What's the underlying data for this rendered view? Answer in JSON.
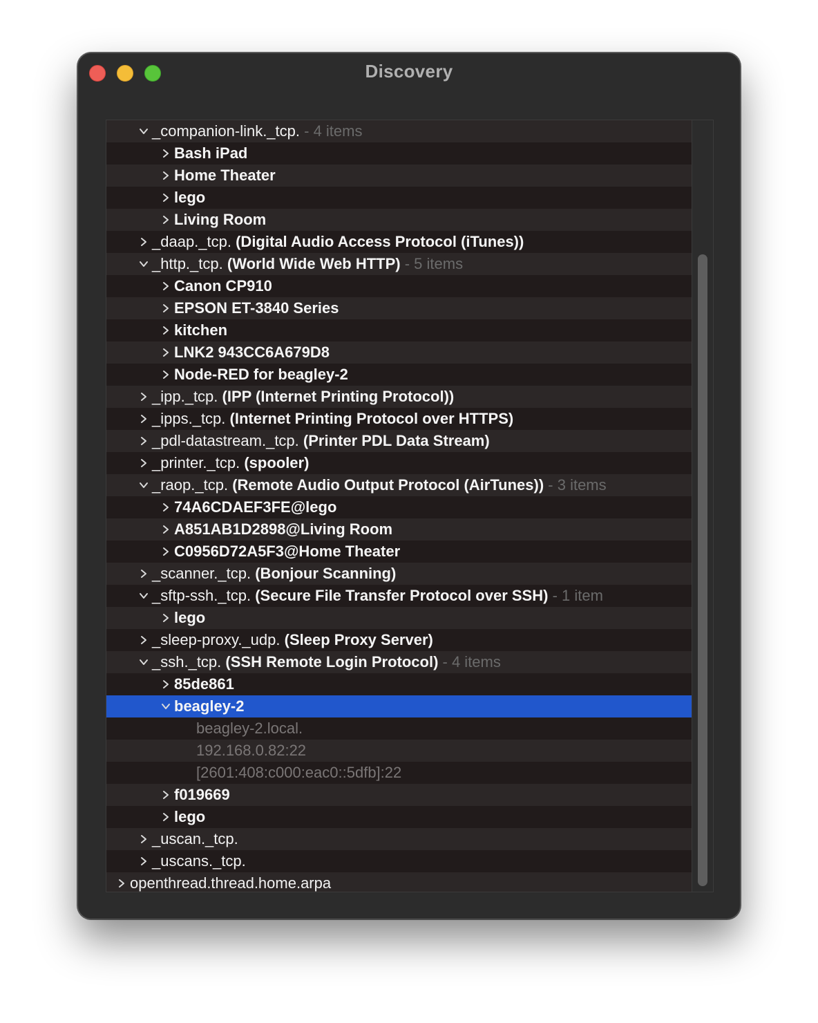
{
  "window": {
    "title": "Discovery"
  },
  "tree": {
    "rows": [
      {
        "indent": 1,
        "expanded": true,
        "name": "_companion-link._tcp.",
        "desc": "",
        "count": " - 4 items",
        "style": "service"
      },
      {
        "indent": 2,
        "expanded": false,
        "name": "Bash iPad",
        "style": "instance"
      },
      {
        "indent": 2,
        "expanded": false,
        "name": "Home Theater",
        "style": "instance"
      },
      {
        "indent": 2,
        "expanded": false,
        "name": "lego",
        "style": "instance"
      },
      {
        "indent": 2,
        "expanded": false,
        "name": "Living Room",
        "style": "instance"
      },
      {
        "indent": 1,
        "expanded": false,
        "name": "_daap._tcp.",
        "desc": "(Digital Audio Access Protocol (iTunes))",
        "count": "",
        "style": "service"
      },
      {
        "indent": 1,
        "expanded": true,
        "name": "_http._tcp.",
        "desc": "(World Wide Web HTTP)",
        "count": " - 5 items",
        "style": "service"
      },
      {
        "indent": 2,
        "expanded": false,
        "name": "Canon CP910",
        "style": "instance"
      },
      {
        "indent": 2,
        "expanded": false,
        "name": "EPSON ET-3840 Series",
        "style": "instance"
      },
      {
        "indent": 2,
        "expanded": false,
        "name": "kitchen",
        "style": "instance"
      },
      {
        "indent": 2,
        "expanded": false,
        "name": "LNK2 943CC6A679D8",
        "style": "instance"
      },
      {
        "indent": 2,
        "expanded": false,
        "name": "Node-RED for beagley-2",
        "style": "instance"
      },
      {
        "indent": 1,
        "expanded": false,
        "name": "_ipp._tcp.",
        "desc": "(IPP (Internet Printing Protocol))",
        "count": "",
        "style": "service"
      },
      {
        "indent": 1,
        "expanded": false,
        "name": "_ipps._tcp.",
        "desc": "(Internet Printing Protocol over HTTPS)",
        "count": "",
        "style": "service"
      },
      {
        "indent": 1,
        "expanded": false,
        "name": "_pdl-datastream._tcp.",
        "desc": "(Printer PDL Data Stream)",
        "count": "",
        "style": "service"
      },
      {
        "indent": 1,
        "expanded": false,
        "name": "_printer._tcp.",
        "desc": "(spooler)",
        "count": "",
        "style": "service"
      },
      {
        "indent": 1,
        "expanded": true,
        "name": "_raop._tcp.",
        "desc": "(Remote Audio Output Protocol (AirTunes))",
        "count": " - 3 items",
        "style": "service"
      },
      {
        "indent": 2,
        "expanded": false,
        "name": "74A6CDAEF3FE@lego",
        "style": "instance"
      },
      {
        "indent": 2,
        "expanded": false,
        "name": "A851AB1D2898@Living Room",
        "style": "instance"
      },
      {
        "indent": 2,
        "expanded": false,
        "name": "C0956D72A5F3@Home Theater",
        "style": "instance"
      },
      {
        "indent": 1,
        "expanded": false,
        "name": "_scanner._tcp.",
        "desc": "(Bonjour Scanning)",
        "count": "",
        "style": "service"
      },
      {
        "indent": 1,
        "expanded": true,
        "name": "_sftp-ssh._tcp.",
        "desc": "(Secure File Transfer Protocol over SSH)",
        "count": " - 1 item",
        "style": "service"
      },
      {
        "indent": 2,
        "expanded": false,
        "name": "lego",
        "style": "instance"
      },
      {
        "indent": 1,
        "expanded": false,
        "name": "_sleep-proxy._udp.",
        "desc": "(Sleep Proxy Server)",
        "count": "",
        "style": "service"
      },
      {
        "indent": 1,
        "expanded": true,
        "name": "_ssh._tcp.",
        "desc": "(SSH Remote Login Protocol)",
        "count": " - 4 items",
        "style": "service"
      },
      {
        "indent": 2,
        "expanded": false,
        "name": "85de861",
        "style": "instance"
      },
      {
        "indent": 2,
        "expanded": true,
        "name": "beagley-2",
        "style": "instance",
        "selected": true
      },
      {
        "indent": 3,
        "name": "beagley-2.local.",
        "style": "detail"
      },
      {
        "indent": 3,
        "name": "192.168.0.82:22",
        "style": "detail"
      },
      {
        "indent": 3,
        "name": "[2601:408:c000:eac0::5dfb]:22",
        "style": "detail"
      },
      {
        "indent": 2,
        "expanded": false,
        "name": "f019669",
        "style": "instance"
      },
      {
        "indent": 2,
        "expanded": false,
        "name": "lego",
        "style": "instance"
      },
      {
        "indent": 1,
        "expanded": false,
        "name": "_uscan._tcp.",
        "desc": "",
        "count": "",
        "style": "service"
      },
      {
        "indent": 1,
        "expanded": false,
        "name": "_uscans._tcp.",
        "desc": "",
        "count": "",
        "style": "service"
      },
      {
        "indent": 0,
        "expanded": false,
        "name": "openthread.thread.home.arpa",
        "style": "domain"
      }
    ]
  },
  "colors": {
    "selection": "#2157cc",
    "close": "#ee5e57",
    "minimize": "#f4bd38",
    "zoom": "#58c43a"
  },
  "icons": {
    "expanded": "chevron-down-icon",
    "collapsed": "chevron-right-icon"
  }
}
